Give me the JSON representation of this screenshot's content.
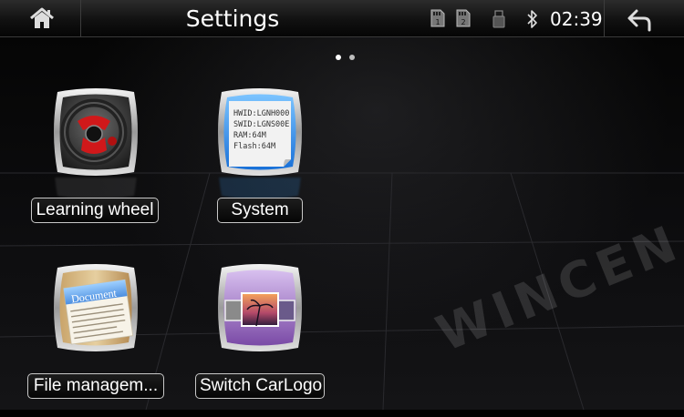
{
  "header": {
    "title": "Settings",
    "clock": "02:39",
    "sd1_label": "1",
    "sd2_label": "2",
    "icons": [
      "home-icon",
      "sd-card-1-icon",
      "sd-card-2-icon",
      "usb-icon",
      "bluetooth-icon",
      "back-arrow-icon"
    ]
  },
  "pager": {
    "total_pages": 2,
    "current_page": 1
  },
  "system_card": {
    "lines": [
      "HWID:LGNH000",
      "SWID:LGNS00E",
      "RAM:64M",
      "Flash:64M"
    ]
  },
  "file_card": {
    "title": "Document"
  },
  "tiles": [
    {
      "label": "Learning wheel",
      "icon": "steering-wheel-icon"
    },
    {
      "label": "System",
      "icon": "system-info-icon"
    },
    {
      "label": "File managem...",
      "icon": "document-icon"
    },
    {
      "label": "Switch CarLogo",
      "icon": "image-gallery-icon"
    }
  ],
  "watermark": "WINCEN",
  "colors": {
    "accent_blue": "#3aa0ff",
    "wheel_red": "#d0181a",
    "background": "#000000"
  }
}
